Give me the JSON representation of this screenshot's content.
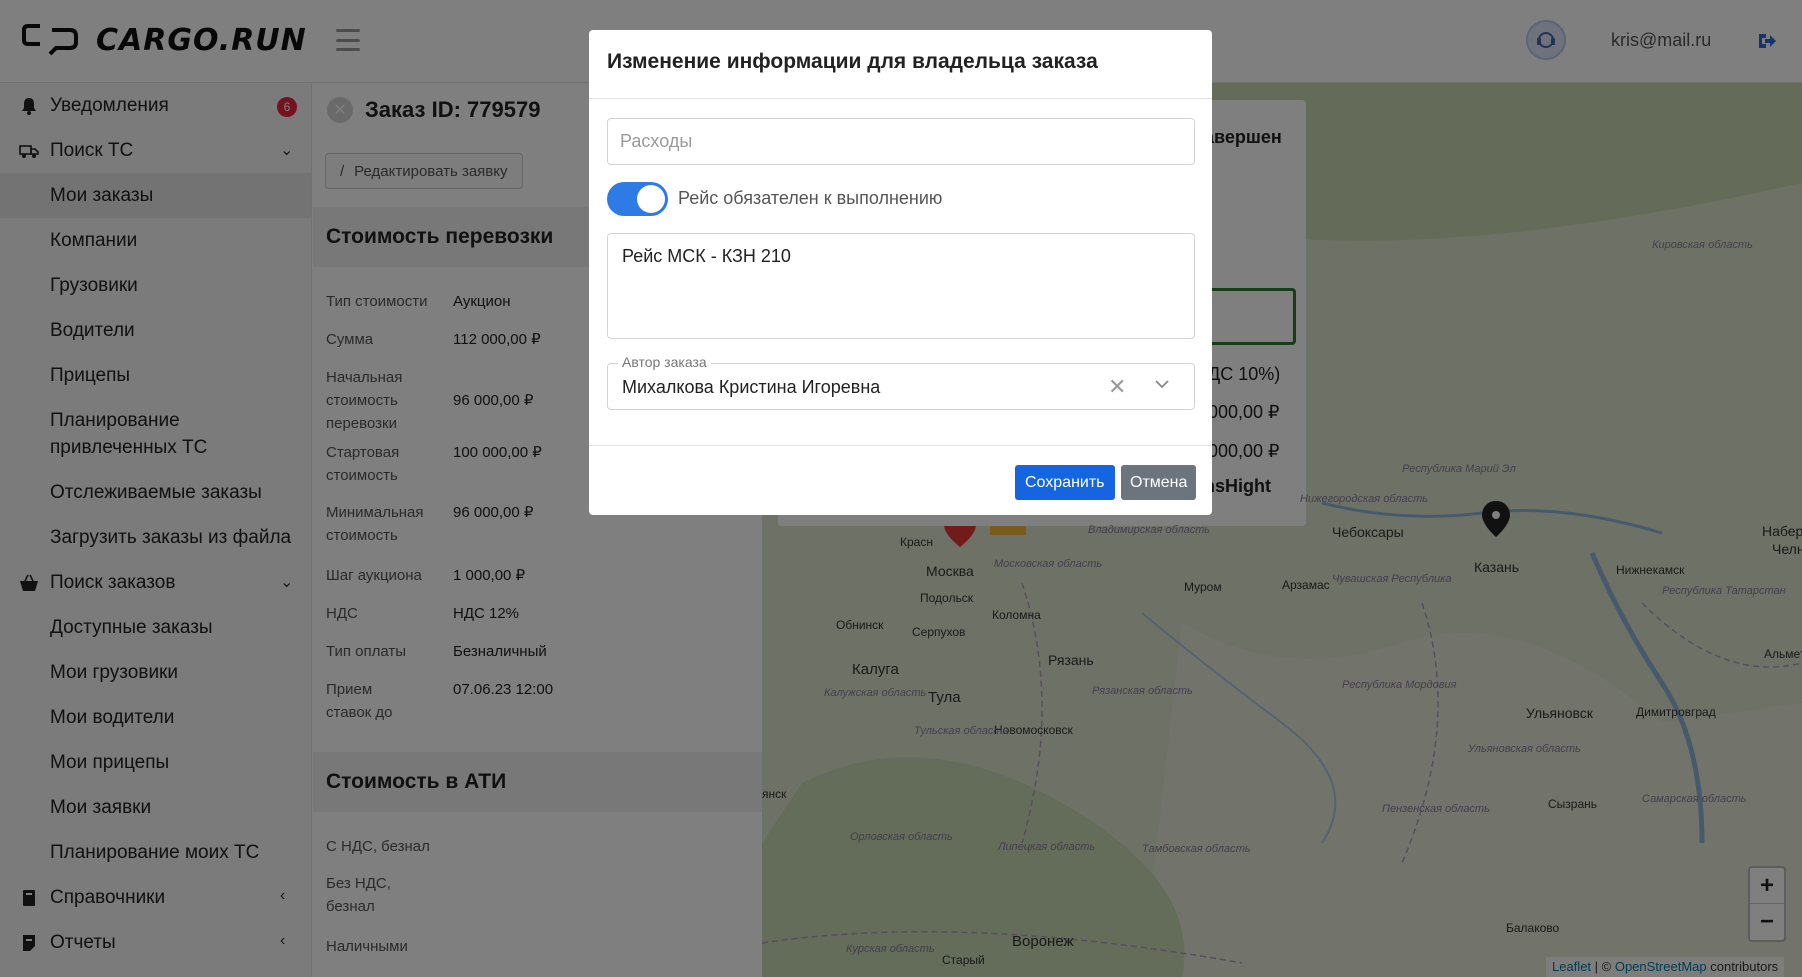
{
  "header": {
    "logo_text": "CARGO.RUN",
    "user_email": "kris@mail.ru"
  },
  "sidebar": {
    "notifications": {
      "label": "Уведомления",
      "badge": "6"
    },
    "search_tc": {
      "label": "Поиск ТС",
      "items": [
        "Мои заказы",
        "Компании",
        "Грузовики",
        "Водители",
        "Прицепы",
        "Планирование привлеченных ТС",
        "Отслеживаемые заказы",
        "Загрузить заказы из файла"
      ]
    },
    "search_orders": {
      "label": "Поиск заказов",
      "items": [
        "Доступные заказы",
        "Мои грузовики",
        "Мои водители",
        "Мои прицепы",
        "Мои заявки",
        "Планирование моих ТС"
      ]
    },
    "references": {
      "label": "Справочники"
    },
    "reports": {
      "label": "Отчеты"
    }
  },
  "order": {
    "title": "Заказ ID: 779579",
    "edit_button": "Редактировать заявку",
    "cost_section": "Стоимость перевозки",
    "fields": [
      {
        "k": "Тип стоимости",
        "v": "Аукцион"
      },
      {
        "k": "Сумма",
        "v": "112 000,00 ₽"
      },
      {
        "k": "Начальная стоимость перевозки",
        "v": "96 000,00 ₽"
      },
      {
        "k": "Стартовая стоимость",
        "v": "100 000,00 ₽"
      },
      {
        "k": "Минимальная стоимость",
        "v": "96 000,00 ₽"
      },
      {
        "k": "Шаг аукциона",
        "v": "1 000,00 ₽"
      },
      {
        "k": "НДС",
        "v": "НДС 12%"
      },
      {
        "k": "Тип оплаты",
        "v": "Безналичный"
      },
      {
        "k": "Прием ставок до",
        "v": "07.06.23 12:00"
      }
    ],
    "ati_section": "Стоимость в АТИ",
    "ati_fields": [
      "С НДС, безнал",
      "Без НДС, безнал",
      "Наличными"
    ]
  },
  "info_card": {
    "status_fragment": "авершен",
    "vat_fragment": "ДС 10%)",
    "amount1": "000,00 ₽",
    "amount2": "000,00 ₽",
    "company_fragment": "nsHight"
  },
  "map": {
    "cities": [
      "Москва",
      "Подольск",
      "Обнинск",
      "Серпухов",
      "Коломна",
      "Калуга",
      "Тула",
      "Новомосковск",
      "Рязань",
      "Муром",
      "Арзамас",
      "Чебоксары",
      "Казань",
      "Нижнекамск",
      "Ульяновск",
      "Димитровград",
      "Сызрань",
      "Воронеж",
      "Балаково",
      "Старый",
      "Набере",
      "Челн",
      "Альметь",
      "Красн",
      "янск"
    ],
    "regions": [
      "Владимирская область",
      "Московская область",
      "Калужская область",
      "Тульская область",
      "Рязанская область",
      "Орловская область",
      "Липецкая область",
      "Тамбовская область",
      "Пензенская область",
      "Ульяновская область",
      "Республика Мордовия",
      "Чувашская Республика",
      "Республика Марий Эл",
      "Республика Татарстан",
      "Самарская область",
      "Курская область",
      "Кировская область",
      "Нижегородская область"
    ],
    "zoom_in": "+",
    "zoom_out": "−",
    "attribution": {
      "leaflet": "Leaflet",
      "sep": " | © ",
      "osm": "OpenStreetMap",
      "contributors": " contributors"
    }
  },
  "modal": {
    "title": "Изменение информации для владельца заказа",
    "expenses_placeholder": "Расходы",
    "toggle_label": "Рейс обязателен к выполнению",
    "toggle_on": true,
    "comment": "Рейс МСК - КЗН 210",
    "author_legend": "Автор заказа",
    "author_value": "Михалкова Кристина Игоревна",
    "save": "Сохранить",
    "cancel": "Отмена"
  },
  "colors": {
    "primary": "#1565e0",
    "toggle": "#2f7be6",
    "cancel": "#6c757d",
    "badge": "#e8263b"
  }
}
